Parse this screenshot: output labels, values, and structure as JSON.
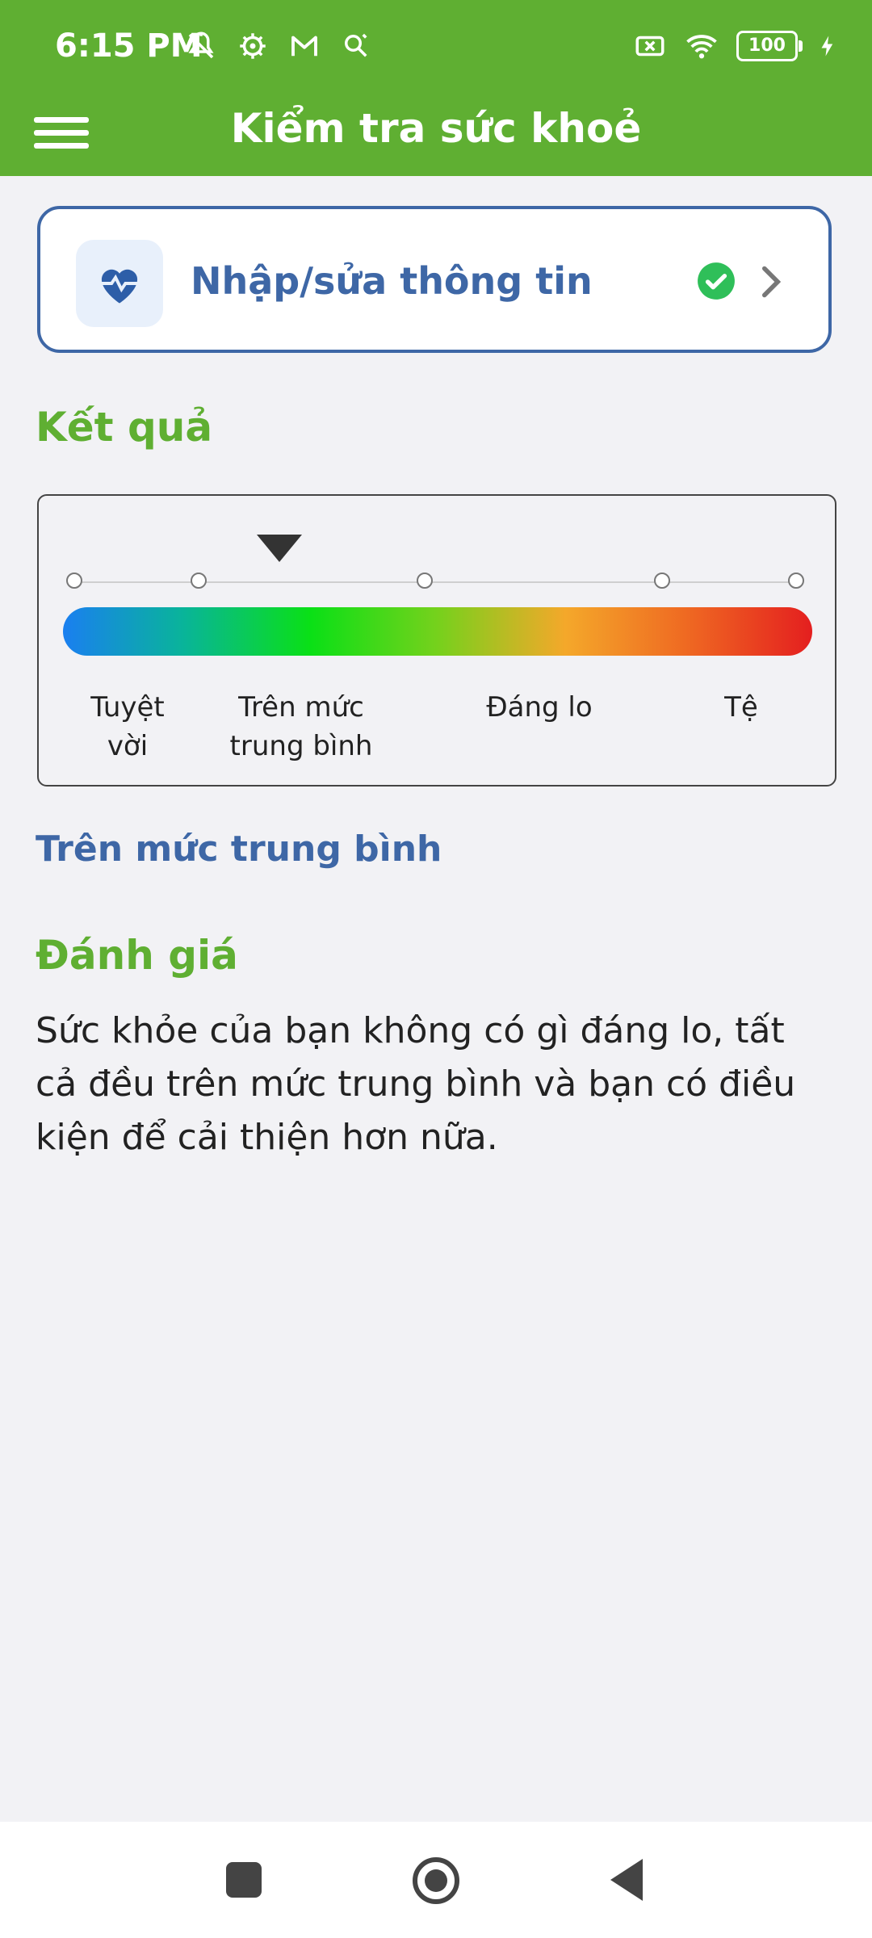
{
  "status_bar": {
    "time": "6:15 PM",
    "battery": "100",
    "icons": [
      "mute-icon",
      "settings-icon",
      "gmail-icon",
      "search-icon",
      "sim-icon",
      "wifi-icon",
      "battery-icon",
      "charging-icon"
    ]
  },
  "app_bar": {
    "title": "Kiểm tra sức khoẻ"
  },
  "info_card": {
    "label": "Nhập/sửa thông tin",
    "status": "completed"
  },
  "result": {
    "title": "Kết quả",
    "scale_labels": [
      "Tuyệt vời",
      "Trên mức trung bình",
      "Đáng lo",
      "Tệ"
    ],
    "current_level": "Trên mức trung bình"
  },
  "evaluation": {
    "title": "Đánh giá",
    "text": "Sức khỏe của bạn không có gì đáng lo, tất cả đều trên mức trung bình và bạn có điều kiện để cải thiện hơn nữa."
  },
  "colors": {
    "primary_green": "#5faf32",
    "primary_blue": "#3e67a6",
    "success_green": "#2fbf59"
  }
}
